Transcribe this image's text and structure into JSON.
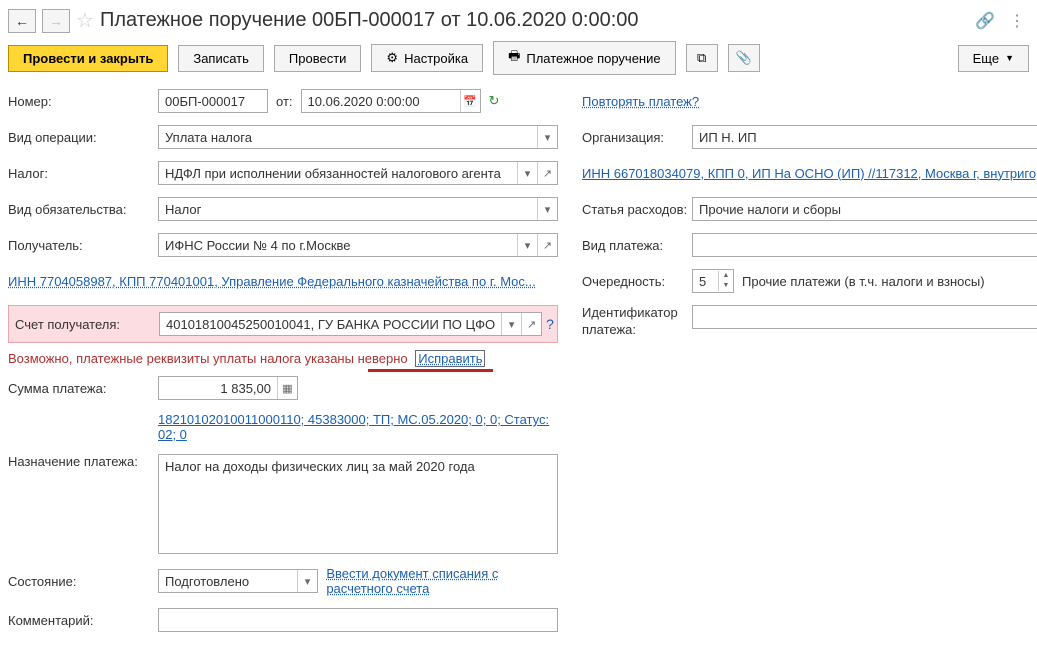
{
  "header": {
    "title": "Платежное поручение 00БП-000017 от 10.06.2020 0:00:00"
  },
  "toolbar": {
    "post_close": "Провести и закрыть",
    "save": "Записать",
    "post": "Провести",
    "settings": "Настройка",
    "print": "Платежное поручение",
    "more": "Еще"
  },
  "left": {
    "number_lbl": "Номер:",
    "number_val": "00БП-000017",
    "from_lbl": "от:",
    "date_val": "10.06.2020  0:00:00",
    "optype_lbl": "Вид операции:",
    "optype_val": "Уплата налога",
    "tax_lbl": "Налог:",
    "tax_val": "НДФЛ при исполнении обязанностей налогового агента",
    "obligation_lbl": "Вид обязательства:",
    "obligation_val": "Налог",
    "recipient_lbl": "Получатель:",
    "recipient_val": "ИФНС России № 4 по г.Москве",
    "recipient_link": "ИНН 7704058987, КПП 770401001, Управление Федерального казначейства по г. Мос...",
    "account_lbl": "Счет получателя:",
    "account_val": "40101810045250010041, ГУ БАНКА РОССИИ ПО ЦФО",
    "warn_text": "Возможно, платежные реквизиты уплаты налога указаны неверно",
    "fix_link": "Исправить",
    "amount_lbl": "Сумма платежа:",
    "amount_val": "1 835,00",
    "kbk_link": "18210102010011000110; 45383000; ТП; МС.05.2020; 0; 0; Статус: 02; 0",
    "purpose_lbl": "Назначение платежа:",
    "purpose_val": "Налог на доходы физических лиц за май 2020 года",
    "state_lbl": "Состояние:",
    "state_val": "Подготовлено",
    "state_link": "Ввести документ списания с расчетного счета",
    "comment_lbl": "Комментарий:",
    "comment_val": ""
  },
  "right": {
    "repeat_link": "Повторять платеж?",
    "org_lbl": "Организация:",
    "org_val": "ИП Н. ИП",
    "org_link": "ИНН 667018034079, КПП 0, ИП На ОСНО (ИП) //117312, Москва г, внутригоро",
    "expense_lbl": "Статья расходов:",
    "expense_val": "Прочие налоги и сборы",
    "paytype_lbl": "Вид платежа:",
    "paytype_val": "",
    "priority_lbl": "Очередность:",
    "priority_val": "5",
    "priority_txt": "Прочие платежи (в т.ч. налоги и взносы)",
    "ident_lbl": "Идентификатор платежа:",
    "ident_val": ""
  }
}
